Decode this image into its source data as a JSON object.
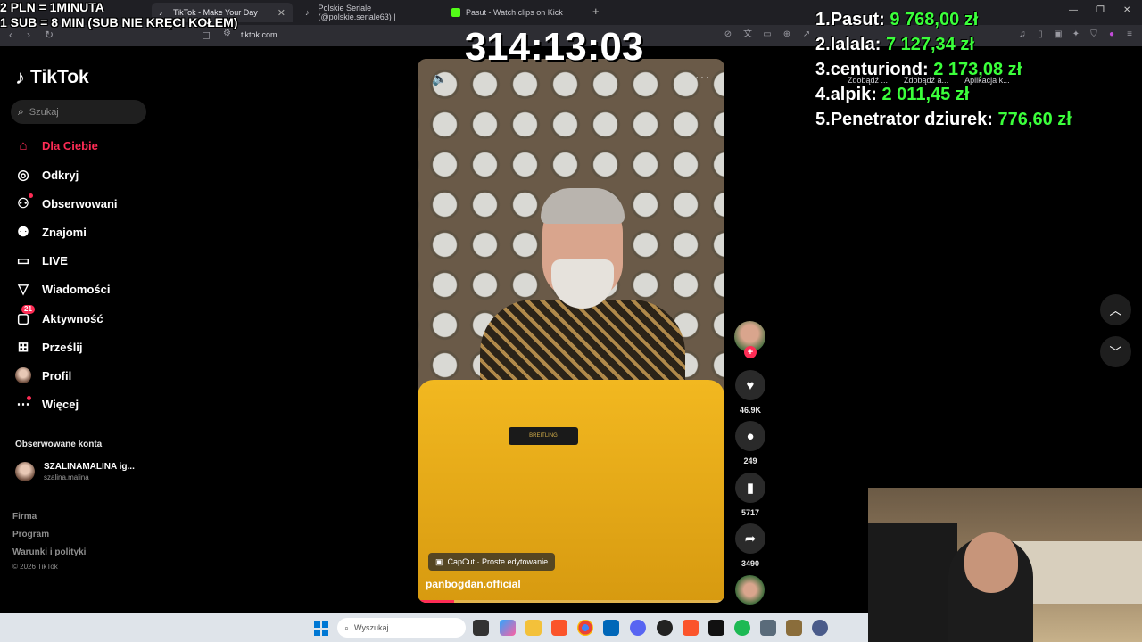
{
  "overlay": {
    "rate_line1": "2 PLN =  1MINUTA",
    "rate_line2": "1 SUB = 8 MIN (SUB NIE KRĘCI KOŁEM)",
    "timer": "314:13:03",
    "leaderboard": [
      {
        "rank": "1.",
        "name": "Pasut:",
        "amount": "9 768,00 zł"
      },
      {
        "rank": "2.",
        "name": "lalala:",
        "amount": "7 127,34 zł"
      },
      {
        "rank": "3.",
        "name": "centuriond:",
        "amount": "2 173,08 zł"
      },
      {
        "rank": "4.",
        "name": "alpik:",
        "amount": "2 011,45 zł"
      },
      {
        "rank": "5.",
        "name": "Penetrator dziurek:",
        "amount": "776,60 zł"
      }
    ]
  },
  "browser": {
    "tabs": [
      {
        "label": "TikTok - Make Your Day"
      },
      {
        "label": "Polskie Seriale (@polskie.seriale63) |"
      },
      {
        "label": "Pasut - Watch clips on Kick"
      }
    ],
    "url": "tiktok.com",
    "bookmarks": [
      "Zdobądź ...",
      "Zdobądź a...",
      "Aplikacja k..."
    ]
  },
  "tiktok": {
    "logo": "TikTok",
    "search_placeholder": "Szukaj",
    "nav": [
      {
        "label": "Dla Ciebie",
        "icon": "home-icon"
      },
      {
        "label": "Odkryj",
        "icon": "compass-icon"
      },
      {
        "label": "Obserwowani",
        "icon": "following-icon"
      },
      {
        "label": "Znajomi",
        "icon": "friends-icon"
      },
      {
        "label": "LIVE",
        "icon": "live-icon"
      },
      {
        "label": "Wiadomości",
        "icon": "messages-icon"
      },
      {
        "label": "Aktywność",
        "icon": "activity-icon",
        "badge": "21"
      },
      {
        "label": "Prześlij",
        "icon": "upload-icon"
      },
      {
        "label": "Profil",
        "icon": "profile-avatar-icon"
      },
      {
        "label": "Więcej",
        "icon": "more-icon"
      }
    ],
    "followed_title": "Obserwowane konta",
    "followed_accounts": [
      {
        "name": "SZALINAMALINA ig...",
        "handle": "szalina.malina"
      }
    ],
    "footer": [
      "Firma",
      "Program",
      "Warunki i polityki"
    ],
    "copyright": "© 2026 TikTok",
    "accent_color": "#fe2c55"
  },
  "video": {
    "capcut_tag": "CapCut · Proste edytowanie",
    "author": "panbogdan.official",
    "case_brand": "BREITLING",
    "progress": 0.12,
    "likes": "46.9K",
    "comments": "249",
    "saves": "5717",
    "shares": "3490"
  },
  "taskbar": {
    "search_placeholder": "Wyszukaj"
  }
}
